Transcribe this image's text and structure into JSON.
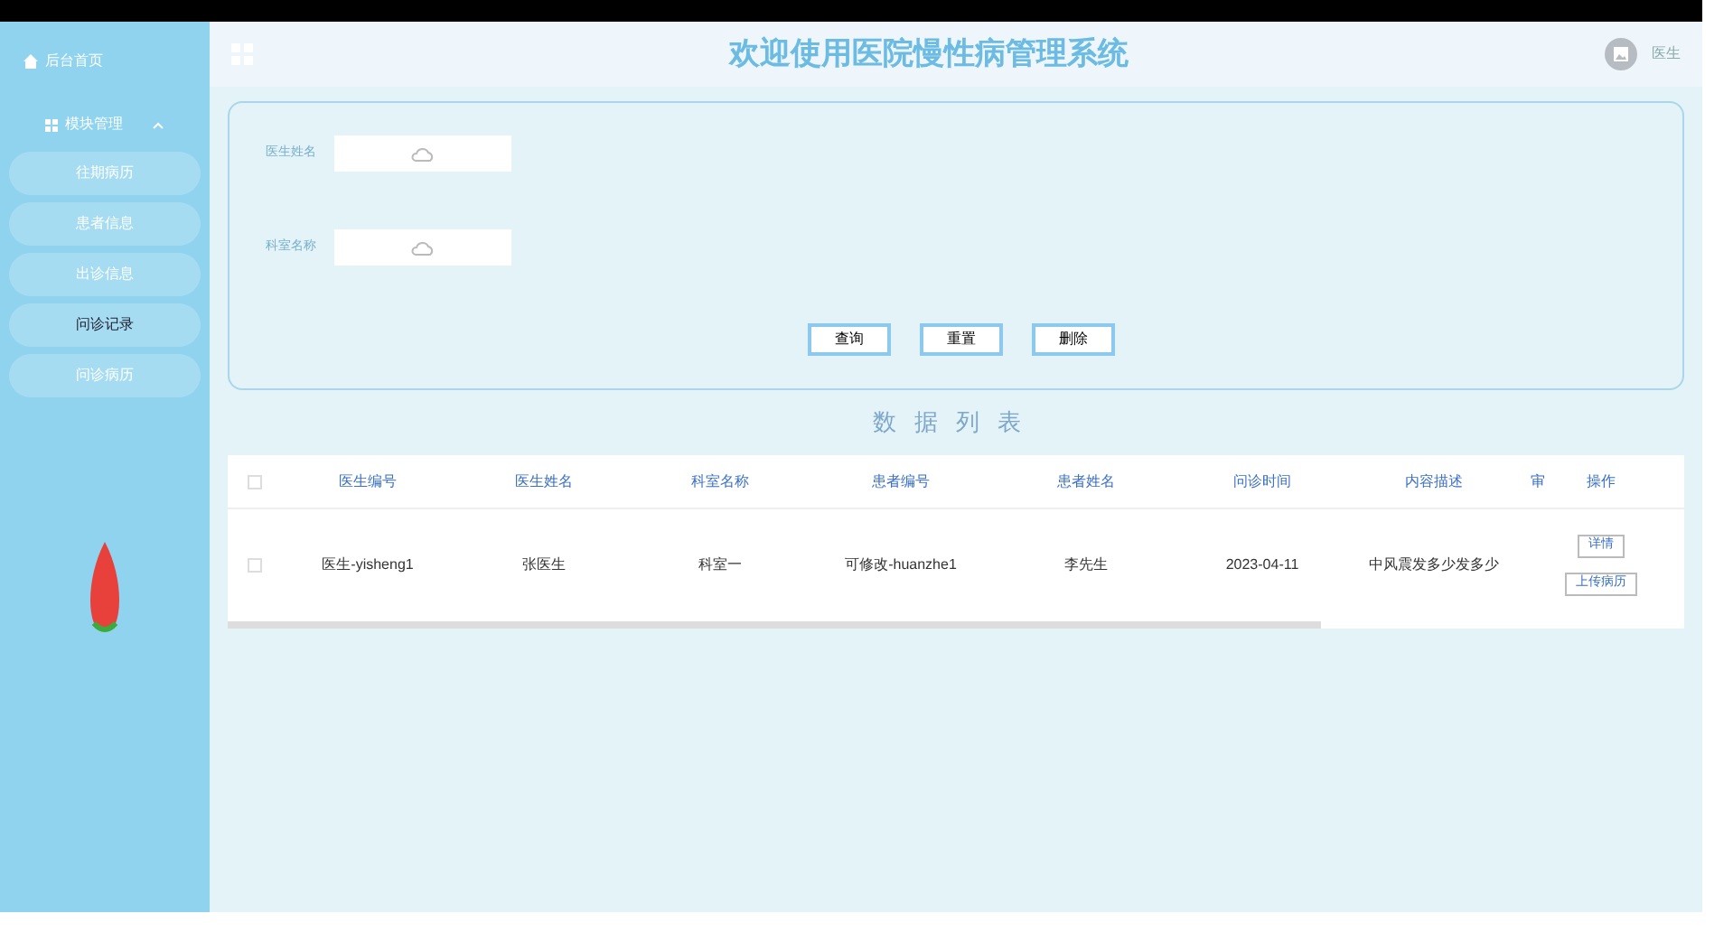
{
  "sidebar": {
    "home": "后台首页",
    "group": {
      "label": "模块管理",
      "expanded": true
    },
    "items": [
      {
        "label": "往期病历",
        "selected": false
      },
      {
        "label": "患者信息",
        "selected": false
      },
      {
        "label": "出诊信息",
        "selected": false
      },
      {
        "label": "问诊记录",
        "selected": true
      },
      {
        "label": "问诊病历",
        "selected": false
      }
    ]
  },
  "header": {
    "title": "欢迎使用医院慢性病管理系统",
    "user": "医生"
  },
  "search": {
    "fields": [
      {
        "label": "医生姓名"
      },
      {
        "label": "科室名称"
      }
    ],
    "buttons": [
      "查询",
      "重置",
      "删除"
    ]
  },
  "table": {
    "title": "数据列表",
    "all_checked": false,
    "columns": [
      "医生编号",
      "医生姓名",
      "科室名称",
      "患者编号",
      "患者姓名",
      "问诊时间",
      "内容描述",
      "审",
      "操作"
    ],
    "rows": [
      {
        "checked": false,
        "cells": [
          "医生-yisheng1",
          "张医生",
          "科室一",
          "可修改-huanzhe1",
          "李先生",
          "2023-04-11",
          "中风震发多少发多少"
        ],
        "actions": [
          "详情",
          "上传病历"
        ]
      }
    ]
  }
}
